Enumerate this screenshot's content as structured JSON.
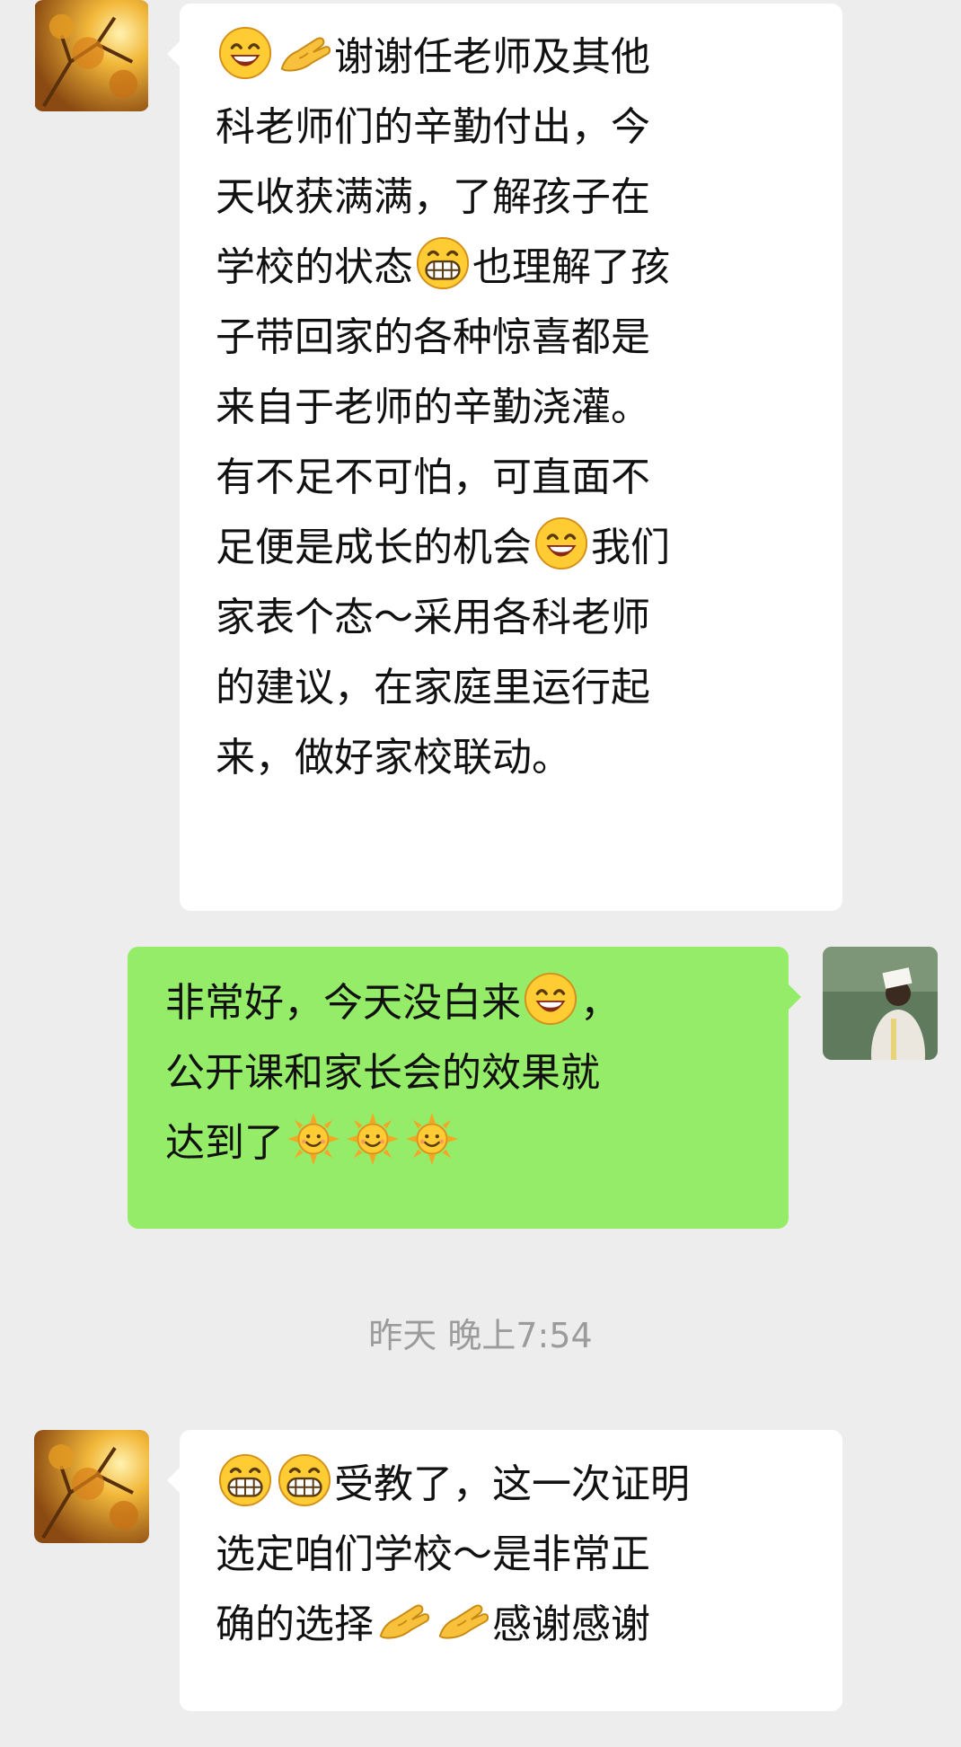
{
  "colors": {
    "background": "#ededed",
    "incoming_bubble": "#ffffff",
    "outgoing_bubble": "#95ec69",
    "timestamp": "#9b9b9b"
  },
  "messages": [
    {
      "direction": "incoming",
      "avatar": "autumn-tree-avatar",
      "lines": [
        [
          {
            "emoji": "grinning-face-icon"
          },
          {
            "emoji": "ok-hand-icon"
          },
          {
            "text": "谢谢任老师及其他"
          }
        ],
        [
          {
            "text": "科老师们的辛勤付出，今"
          }
        ],
        [
          {
            "text": "天收获满满，了解孩子在"
          }
        ],
        [
          {
            "text": "学校的状态"
          },
          {
            "emoji": "big-grin-icon"
          },
          {
            "text": "也理解了孩"
          }
        ],
        [
          {
            "text": "子带回家的各种惊喜都是"
          }
        ],
        [
          {
            "text": "来自于老师的辛勤浇灌。"
          }
        ],
        [
          {
            "text": "有不足不可怕，可直面不"
          }
        ],
        [
          {
            "text": "足便是成长的机会"
          },
          {
            "emoji": "grinning-face-icon"
          },
          {
            "text": "我们"
          }
        ],
        [
          {
            "text": "家表个态～采用各科老师"
          }
        ],
        [
          {
            "text": "的建议，在家庭里运行起"
          }
        ],
        [
          {
            "text": "来，做好家校联动。"
          }
        ]
      ]
    },
    {
      "direction": "outgoing",
      "avatar": "reading-person-avatar",
      "lines": [
        [
          {
            "text": "非常好，今天没白来"
          },
          {
            "emoji": "grinning-face-icon"
          },
          {
            "text": "，"
          }
        ],
        [
          {
            "text": "公开课和家长会的效果就"
          }
        ],
        [
          {
            "text": "达到了"
          },
          {
            "emoji": "sun-face-icon"
          },
          {
            "emoji": "sun-face-icon"
          },
          {
            "emoji": "sun-face-icon"
          }
        ]
      ]
    },
    {
      "direction": "incoming",
      "avatar": "autumn-tree-avatar",
      "lines": [
        [
          {
            "emoji": "big-grin-icon"
          },
          {
            "emoji": "big-grin-icon"
          },
          {
            "text": "受教了，这一次证明"
          }
        ],
        [
          {
            "text": "选定咱们学校～是非常正"
          }
        ],
        [
          {
            "text": "确的选择"
          },
          {
            "emoji": "ok-hand-icon"
          },
          {
            "emoji": "ok-hand-icon"
          },
          {
            "text": "感谢感谢"
          }
        ]
      ]
    }
  ],
  "timestamp": {
    "label": "昨天 晚上7:54"
  }
}
